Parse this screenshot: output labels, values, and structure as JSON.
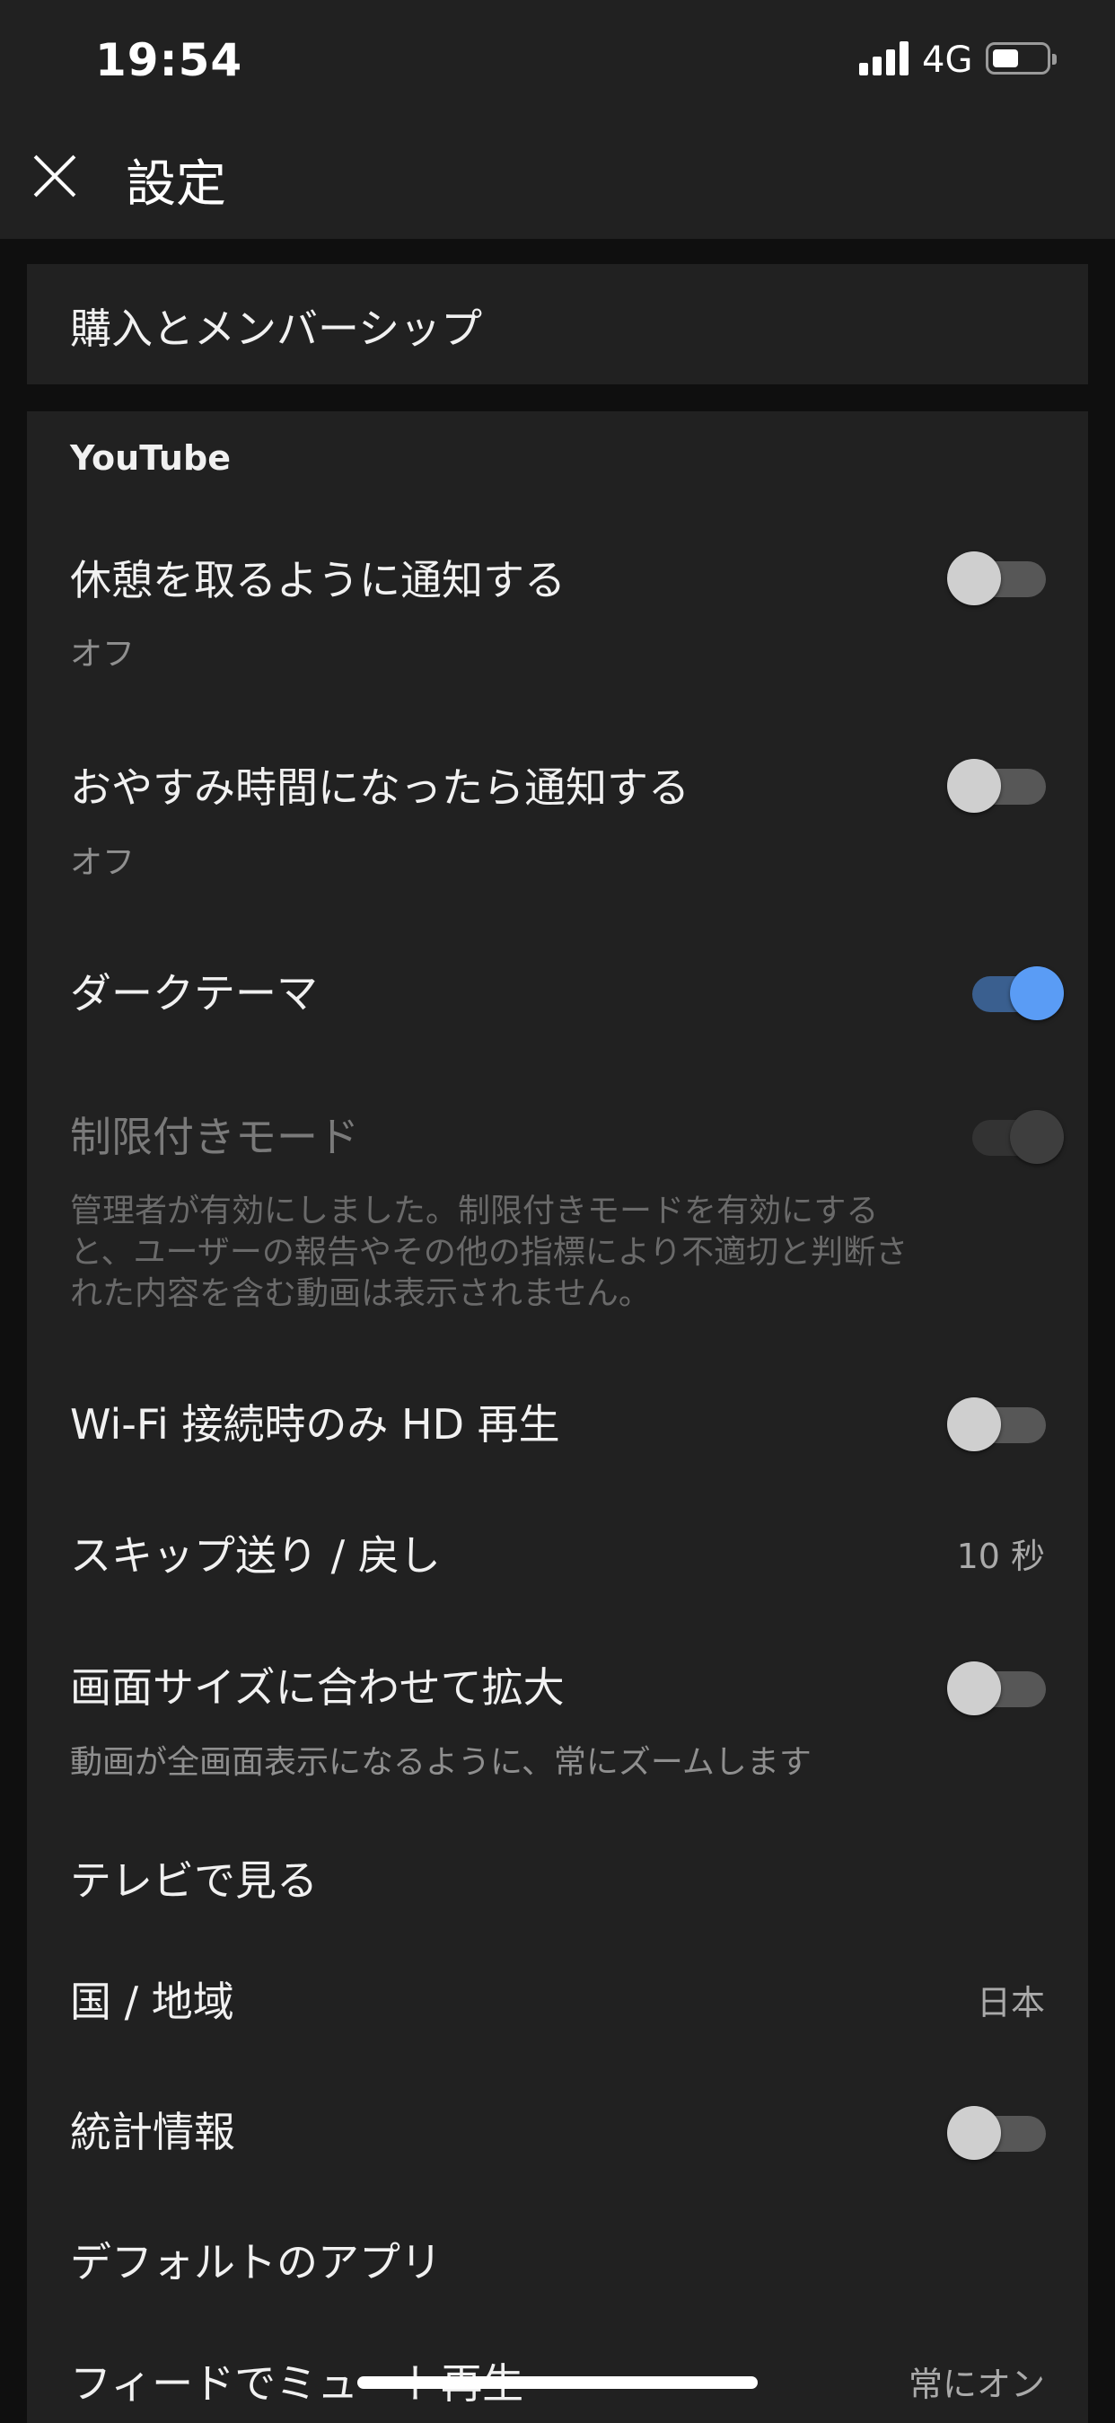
{
  "status_bar": {
    "time": "19:54",
    "network": "4G"
  },
  "header": {
    "title": "設定"
  },
  "purchase": {
    "label": "購入とメンバーシップ"
  },
  "section": {
    "title": "YouTube"
  },
  "settings": [
    {
      "title": "休憩を取るように通知する",
      "subtitle": "オフ",
      "control": "toggle",
      "on": false
    },
    {
      "title": "おやすみ時間になったら通知する",
      "subtitle": "オフ",
      "control": "toggle",
      "on": false
    },
    {
      "title": "ダークテーマ",
      "control": "toggle",
      "on": true
    },
    {
      "title": "制限付きモード",
      "subtitle": "管理者が有効にしました。制限付きモードを有効にすると、ユーザーの報告やその他の指標により不適切と判断された内容を含む動画は表示されません。",
      "control": "toggle",
      "on": true,
      "disabled": true
    },
    {
      "title": "Wi-Fi 接続時のみ HD 再生",
      "control": "toggle",
      "on": false
    },
    {
      "title": "スキップ送り / 戻し",
      "value": "10 秒"
    },
    {
      "title": "画面サイズに合わせて拡大",
      "subtitle": "動画が全画面表示になるように、常にズームします",
      "control": "toggle",
      "on": false
    },
    {
      "title": "テレビで見る"
    },
    {
      "title": "国 / 地域",
      "value": "日本"
    },
    {
      "title": "統計情報",
      "control": "toggle",
      "on": false
    },
    {
      "title": "デフォルトのアプリ"
    },
    {
      "title": "フィードでミュート再生",
      "value": "常にオン"
    }
  ],
  "colors": {
    "accent": "#5a9cf5",
    "surface": "#212121",
    "background": "#0f0f0f"
  }
}
